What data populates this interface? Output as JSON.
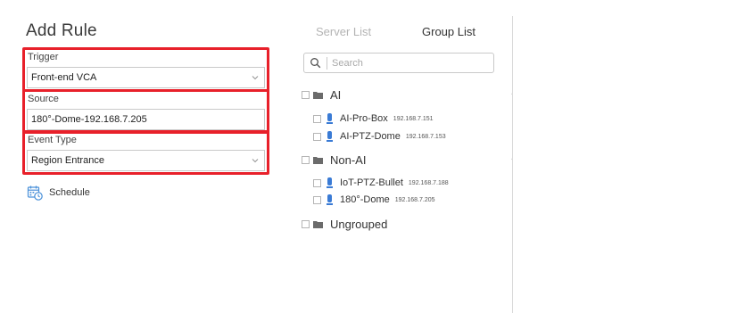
{
  "title": "Add Rule",
  "trigger": {
    "label": "Trigger",
    "value": "Front-end VCA"
  },
  "source": {
    "label": "Source",
    "value": "180°-Dome-192.168.7.205"
  },
  "event_type": {
    "label": "Event Type",
    "value": "Region Entrance"
  },
  "schedule": {
    "label": "Schedule"
  },
  "tabs": {
    "server_list": "Server List",
    "group_list": "Group List"
  },
  "search": {
    "placeholder": "Search",
    "value": ""
  },
  "tree": {
    "groups": [
      {
        "name": "AI",
        "devices": [
          {
            "name": "AI-Pro-Box",
            "ip": "192.168.7.151"
          },
          {
            "name": "AI-PTZ-Dome",
            "ip": "192.168.7.153"
          }
        ]
      },
      {
        "name": "Non-AI",
        "devices": [
          {
            "name": "IoT-PTZ-Bullet",
            "ip": "192.168.7.188"
          },
          {
            "name": "180°-Dome",
            "ip": "192.168.7.205"
          }
        ]
      },
      {
        "name": "Ungrouped",
        "devices": []
      }
    ]
  },
  "colors": {
    "highlight": "#e8202a",
    "device_icon": "#3a7bd5",
    "tab_inactive": "#b4b4b4",
    "schedule_icon": "#4a90d9"
  },
  "icons": {
    "search": "magnifier-icon",
    "folder": "folder-icon",
    "device": "camera-device-icon",
    "dropdown": "chevron-down-icon",
    "schedule": "calendar-clock-icon"
  }
}
